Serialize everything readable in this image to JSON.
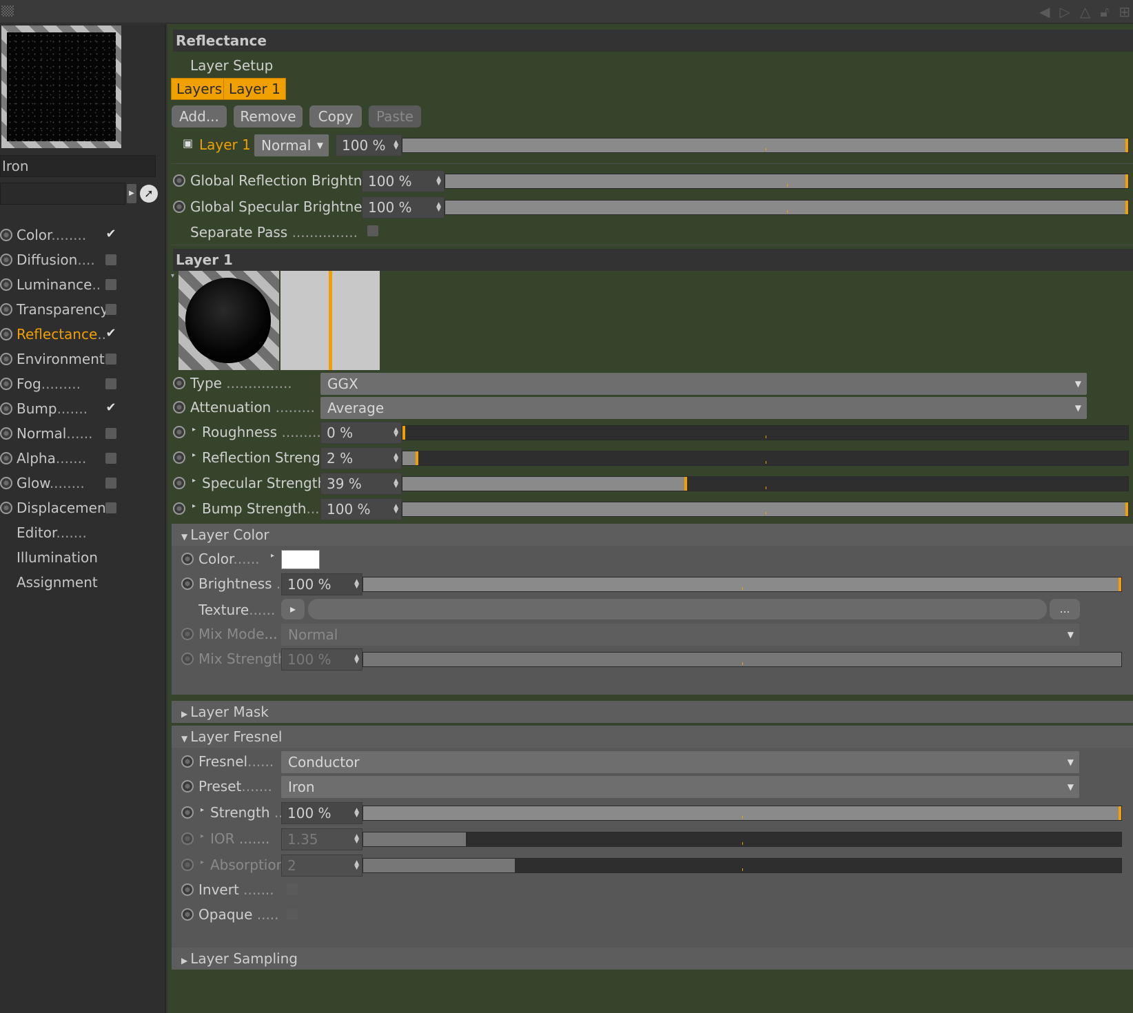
{
  "sidebar": {
    "material_name": "Iron",
    "channels": [
      {
        "label": "Color",
        "dots": "........",
        "checked": true,
        "radio": true
      },
      {
        "label": "Diffusion",
        "dots": "....",
        "checked": false,
        "radio": true
      },
      {
        "label": "Luminance",
        "dots": "..",
        "checked": false,
        "radio": true
      },
      {
        "label": "Transparency",
        "dots": "",
        "checked": false,
        "radio": true
      },
      {
        "label": "Reflectance",
        "dots": "..",
        "checked": true,
        "radio": true,
        "active": true
      },
      {
        "label": "Environment",
        "dots": "",
        "checked": false,
        "radio": true
      },
      {
        "label": "Fog",
        "dots": ".........",
        "checked": false,
        "radio": true
      },
      {
        "label": "Bump",
        "dots": ".......",
        "checked": true,
        "radio": true
      },
      {
        "label": "Normal",
        "dots": "......",
        "checked": false,
        "radio": true
      },
      {
        "label": "Alpha",
        "dots": ".......",
        "checked": false,
        "radio": true
      },
      {
        "label": "Glow",
        "dots": "........",
        "checked": false,
        "radio": true
      },
      {
        "label": "Displacement",
        "dots": "",
        "checked": false,
        "radio": true
      },
      {
        "label": "Editor",
        "dots": ".......",
        "radio": false
      },
      {
        "label": "Illumination",
        "dots": "",
        "radio": false
      },
      {
        "label": "Assignment",
        "dots": "",
        "radio": false
      }
    ]
  },
  "reflectance": {
    "title": "Reflectance",
    "layer_setup": "Layer Setup",
    "tabs": [
      "Layers",
      "Layer 1"
    ],
    "buttons": {
      "add": "Add...",
      "remove": "Remove",
      "copy": "Copy",
      "paste": "Paste"
    },
    "layer_row": {
      "name": "Layer 1",
      "mode": "Normal",
      "opacity": "100 %",
      "opacity_value": 100
    },
    "global_reflection": {
      "label": "Global Reflection Brightness",
      "value": "100 %",
      "fill": 100
    },
    "global_specular": {
      "label": "Global Specular Brightness",
      "value": "100 %",
      "fill": 100
    },
    "separate_pass": {
      "label": "Separate Pass",
      "dots": "..............."
    }
  },
  "layer1": {
    "title": "Layer 1",
    "type": {
      "label": "Type",
      "dots": "...............",
      "value": "GGX"
    },
    "attenuation": {
      "label": "Attenuation",
      "dots": ".........",
      "value": "Average"
    },
    "roughness": {
      "label": "Roughness",
      "dots": ".........",
      "value": "0 %",
      "fill": 0
    },
    "reflection_strength": {
      "label": "Reflection Strength",
      "value": "2 %",
      "fill": 2
    },
    "specular_strength": {
      "label": "Specular Strength",
      "value": "39 %",
      "fill": 39
    },
    "bump_strength": {
      "label": "Bump Strength",
      "dots": "....",
      "value": "100 %",
      "fill": 100
    }
  },
  "layer_color": {
    "title": "Layer Color",
    "color": {
      "label": "Color",
      "dots": "......",
      "swatch": "#ffffff"
    },
    "brightness": {
      "label": "Brightness",
      "dots": "..",
      "value": "100 %",
      "fill": 100
    },
    "texture": {
      "label": "Texture",
      "dots": "......",
      "more": "..."
    },
    "mix_mode": {
      "label": "Mix Mode",
      "dots": "...",
      "value": "Normal"
    },
    "mix_strength": {
      "label": "Mix Strength",
      "value": "100 %",
      "fill": 100
    }
  },
  "layer_mask": {
    "title": "Layer Mask"
  },
  "layer_fresnel": {
    "title": "Layer Fresnel",
    "fresnel": {
      "label": "Fresnel",
      "dots": "......",
      "value": "Conductor"
    },
    "preset": {
      "label": "Preset",
      "dots": ".......",
      "value": "Iron"
    },
    "strength": {
      "label": "Strength",
      "dots": "..",
      "value": "100 %",
      "fill": 100
    },
    "ior": {
      "label": "IOR",
      "dots": ".......",
      "value": "1.35",
      "fill": 13.5
    },
    "absorption": {
      "label": "Absorption",
      "value": "2",
      "fill": 20
    },
    "invert": {
      "label": "Invert",
      "dots": "......."
    },
    "opaque": {
      "label": "Opaque",
      "dots": "....."
    }
  },
  "layer_sampling": {
    "title": "Layer Sampling"
  },
  "colors": {
    "accent": "#f0a000",
    "panel_bg": "#36442c",
    "group_bg": "#575757"
  }
}
